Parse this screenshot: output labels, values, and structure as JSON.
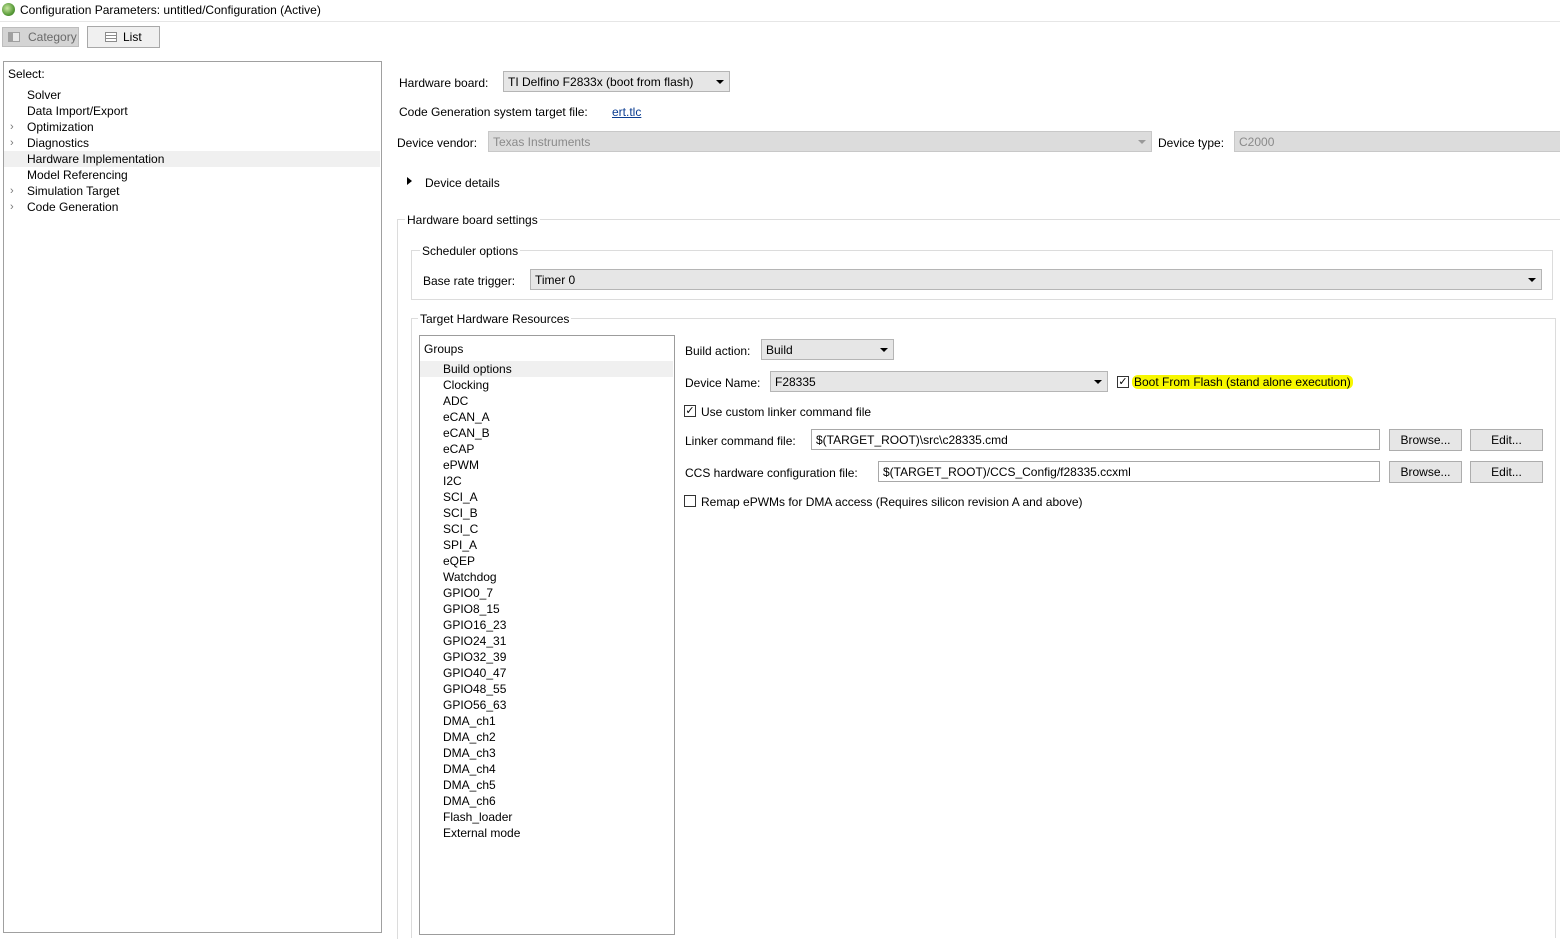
{
  "window": {
    "title": "Configuration Parameters: untitled/Configuration (Active)"
  },
  "toolbar": {
    "category_label": "Category",
    "list_label": "List"
  },
  "tree": {
    "header": "Select:",
    "items": [
      {
        "label": "Solver",
        "expandable": false,
        "selected": false
      },
      {
        "label": "Data Import/Export",
        "expandable": false,
        "selected": false
      },
      {
        "label": "Optimization",
        "expandable": true,
        "selected": false
      },
      {
        "label": "Diagnostics",
        "expandable": true,
        "selected": false
      },
      {
        "label": "Hardware Implementation",
        "expandable": false,
        "selected": true
      },
      {
        "label": "Model Referencing",
        "expandable": false,
        "selected": false
      },
      {
        "label": "Simulation Target",
        "expandable": true,
        "selected": false
      },
      {
        "label": "Code Generation",
        "expandable": true,
        "selected": false
      }
    ]
  },
  "hardware": {
    "board_label": "Hardware board:",
    "board_value": "TI Delfino F2833x (boot from flash)",
    "codegen_label": "Code Generation system target file:",
    "codegen_link": "ert.tlc",
    "vendor_label": "Device vendor:",
    "vendor_value": "Texas Instruments",
    "type_label": "Device type:",
    "type_value": "C2000",
    "device_details": "Device details"
  },
  "board_settings": {
    "title": "Hardware board settings",
    "scheduler": {
      "title": "Scheduler options",
      "base_rate_label": "Base rate trigger:",
      "base_rate_value": "Timer 0"
    },
    "target_resources": {
      "title": "Target Hardware Resources",
      "groups_header": "Groups",
      "groups": [
        "Build options",
        "Clocking",
        "ADC",
        "eCAN_A",
        "eCAN_B",
        "eCAP",
        "ePWM",
        "I2C",
        "SCI_A",
        "SCI_B",
        "SCI_C",
        "SPI_A",
        "eQEP",
        "Watchdog",
        "GPIO0_7",
        "GPIO8_15",
        "GPIO16_23",
        "GPIO24_31",
        "GPIO32_39",
        "GPIO40_47",
        "GPIO48_55",
        "GPIO56_63",
        "DMA_ch1",
        "DMA_ch2",
        "DMA_ch3",
        "DMA_ch4",
        "DMA_ch5",
        "DMA_ch6",
        "Flash_loader",
        "External mode"
      ],
      "selected_group": "Build options",
      "build_action_label": "Build action:",
      "build_action_value": "Build",
      "device_name_label": "Device Name:",
      "device_name_value": "F28335",
      "boot_from_flash_label": "Boot From Flash (stand alone execution)",
      "boot_from_flash_checked": true,
      "custom_linker_label": "Use custom linker command file",
      "custom_linker_checked": true,
      "linker_file_label": "Linker command file:",
      "linker_file_value": "$(TARGET_ROOT)\\src\\c28335.cmd",
      "ccs_config_label": "CCS hardware configuration file:",
      "ccs_config_value": "$(TARGET_ROOT)/CCS_Config/f28335.ccxml",
      "browse_label": "Browse...",
      "edit_label": "Edit...",
      "remap_label": "Remap ePWMs for DMA access (Requires silicon revision A and above)",
      "remap_checked": false
    }
  },
  "colors": {
    "highlight": "#f7f700",
    "selection": "#f0f0f0",
    "link": "#0b3d91"
  }
}
